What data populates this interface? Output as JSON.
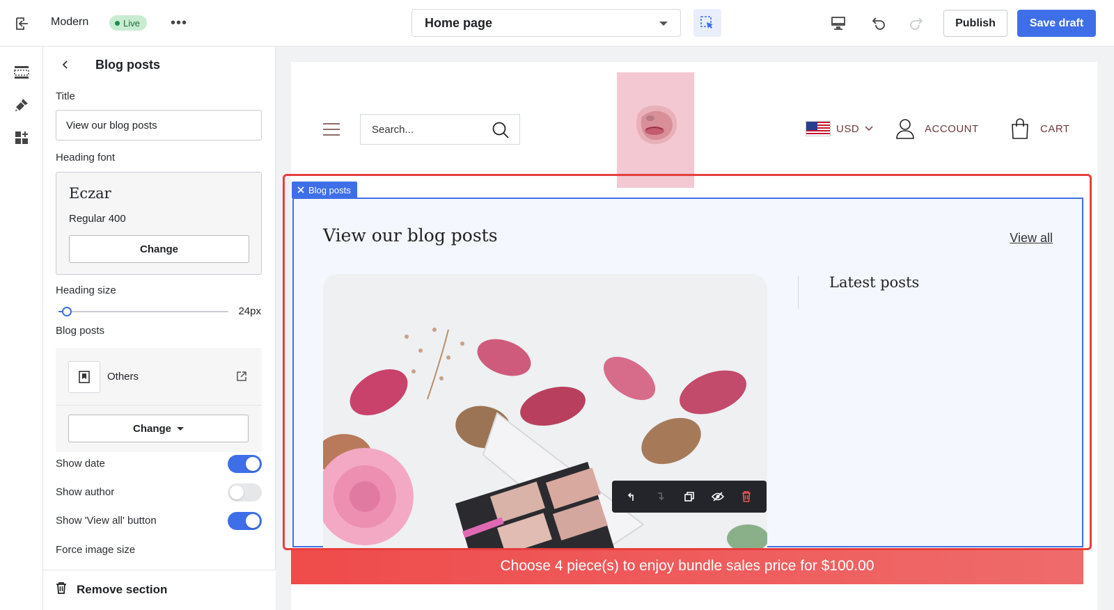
{
  "topbar": {
    "theme_name": "Modern",
    "live_badge": "Live",
    "page_select": "Home page",
    "publish_label": "Publish",
    "save_draft_label": "Save draft"
  },
  "panel": {
    "title": "Blog posts",
    "title_label": "Title",
    "title_value": "View our blog posts",
    "heading_font_label": "Heading font",
    "font_name": "Eczar",
    "font_weight": "Regular 400",
    "font_change_label": "Change",
    "heading_size_label": "Heading size",
    "heading_size_value": "24px",
    "heading_size_fraction": 0.05,
    "blog_posts_label": "Blog posts",
    "blog_name": "Others",
    "blog_change_label": "Change",
    "toggles": [
      {
        "label": "Show date",
        "on": true
      },
      {
        "label": "Show author",
        "on": false
      },
      {
        "label": "Show 'View all' button",
        "on": true
      }
    ],
    "force_image_label": "Force image size",
    "remove_label": "Remove section"
  },
  "store": {
    "search_placeholder": "Search...",
    "currency": "USD",
    "account": "ACCOUNT",
    "cart": "CART"
  },
  "section": {
    "tag": "Blog posts",
    "heading": "View our blog posts",
    "view_all": "View all",
    "latest": "Latest posts"
  },
  "promo_bar": "Choose 4 piece(s) to enjoy bundle sales price for $100.00",
  "colors": {
    "accent": "#3f6fe8",
    "live_bg": "#c8ecd2",
    "selection_outline": "#e53e3e",
    "promo": "#ef4b4b"
  }
}
